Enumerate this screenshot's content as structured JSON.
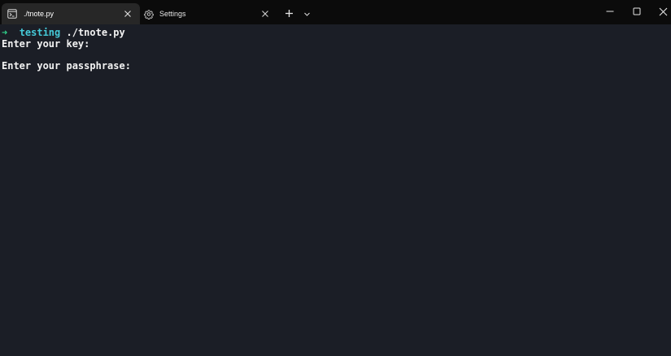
{
  "tabs": [
    {
      "title": "./tnote.py",
      "icon": "terminal-icon",
      "active": true
    },
    {
      "title": "Settings",
      "icon": "gear-icon",
      "active": false
    }
  ],
  "terminal": {
    "prompt_arrow": "➜",
    "prompt_dir": "testing",
    "command": "./tnote.py",
    "lines": [
      "Enter your key:",
      "",
      "Enter your passphrase:"
    ]
  },
  "colors": {
    "titlebar_bg": "#0b0b0b",
    "active_tab_bg": "#272727",
    "terminal_bg": "#1b1e26",
    "prompt_arrow": "#2fd08a",
    "prompt_dir": "#45c9d8",
    "text": "#f2f2f2"
  }
}
